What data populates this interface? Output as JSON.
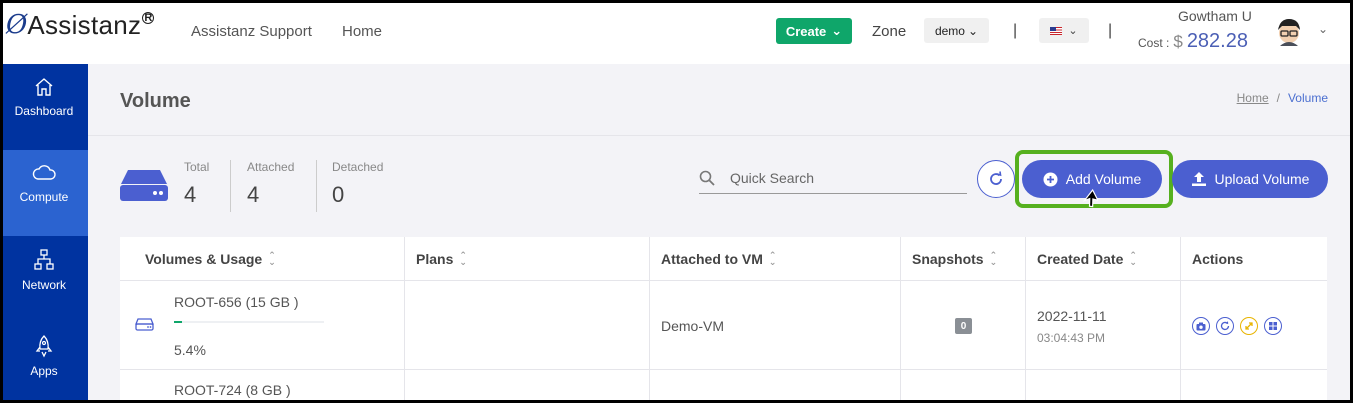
{
  "header": {
    "logo_text": "Assistanz",
    "logo_mark": "Ø",
    "logo_reg": "R",
    "nav": [
      "Assistanz Support",
      "Home"
    ],
    "create_label": "Create",
    "zone_label": "Zone",
    "zone_value": "demo",
    "user_name": "Gowtham U",
    "cost_label": "Cost :",
    "cost_currency": "$",
    "cost_value": "282.28",
    "separator": "|"
  },
  "sidebar": {
    "items": [
      {
        "label": "Dashboard",
        "icon": "home-icon",
        "active": false
      },
      {
        "label": "Compute",
        "icon": "cloud-icon",
        "active": true
      },
      {
        "label": "Network",
        "icon": "network-icon",
        "active": false
      },
      {
        "label": "Apps",
        "icon": "rocket-icon",
        "active": false
      }
    ]
  },
  "page": {
    "title": "Volume",
    "breadcrumb_home": "Home",
    "breadcrumb_sep": "/",
    "breadcrumb_current": "Volume"
  },
  "stats": {
    "total_label": "Total",
    "total_value": "4",
    "attached_label": "Attached",
    "attached_value": "4",
    "detached_label": "Detached",
    "detached_value": "0"
  },
  "search": {
    "placeholder": "Quick Search"
  },
  "buttons": {
    "add_volume": "Add Volume",
    "upload_volume": "Upload Volume"
  },
  "table": {
    "headers": [
      "Volumes & Usage",
      "Plans",
      "Attached to VM",
      "Snapshots",
      "Created Date",
      "Actions"
    ],
    "rows": [
      {
        "name": "ROOT-656 (15 GB )",
        "usage_pct": "5.4%",
        "usage_fraction": 0.054,
        "plan": "",
        "vm": "Demo-VM",
        "snapshots": "0",
        "date": "2022-11-11",
        "time": "03:04:43 PM"
      },
      {
        "name": "ROOT-724 (8 GB )"
      }
    ]
  },
  "colors": {
    "accent": "#4b5fd0",
    "sidebar": "#0033a0",
    "sidebar_active": "#2b63d0",
    "create": "#0fa66a",
    "highlight": "#56b01f"
  }
}
